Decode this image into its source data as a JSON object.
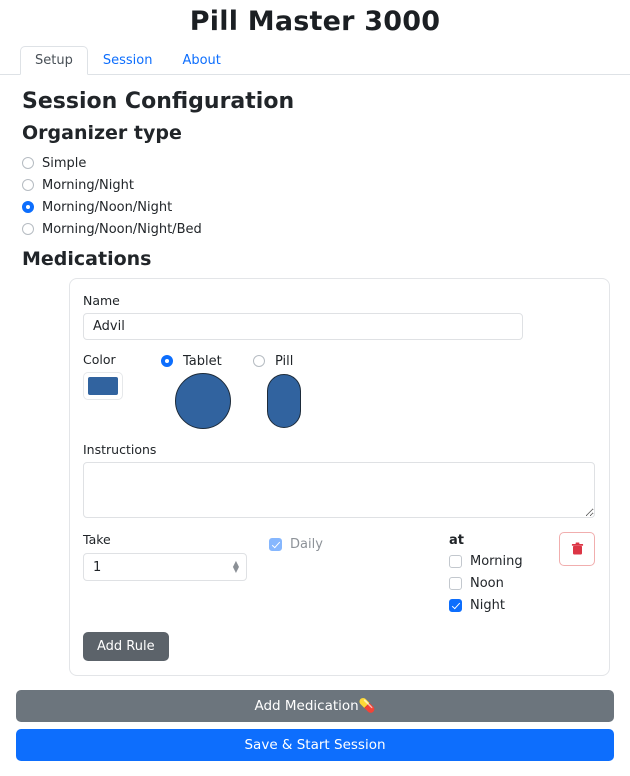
{
  "app": {
    "title": "Pill Master 3000"
  },
  "tabs": [
    {
      "label": "Setup",
      "active": true
    },
    {
      "label": "Session",
      "active": false
    },
    {
      "label": "About",
      "active": false
    }
  ],
  "setup": {
    "section_title": "Session Configuration",
    "organizer": {
      "legend": "Organizer type",
      "options": [
        {
          "label": "Simple",
          "checked": false
        },
        {
          "label": "Morning/Night",
          "checked": false
        },
        {
          "label": "Morning/Noon/Night",
          "checked": true
        },
        {
          "label": "Morning/Noon/Night/Bed",
          "checked": false
        }
      ]
    },
    "medications_title": "Medications",
    "medication": {
      "name_label": "Name",
      "name_value": "Advil",
      "name_placeholder": "",
      "color_label": "Color",
      "color_value": "#31639f",
      "shapes": [
        {
          "label": "Tablet",
          "checked": true
        },
        {
          "label": "Pill",
          "checked": false
        }
      ],
      "instructions_label": "Instructions",
      "instructions_value": "",
      "instructions_placeholder": "",
      "rule": {
        "take_label": "Take",
        "take_value": "1",
        "daily_label": "Daily",
        "daily_checked": true,
        "daily_disabled": true,
        "at_label": "at",
        "times": [
          {
            "label": "Morning",
            "checked": false
          },
          {
            "label": "Noon",
            "checked": false
          },
          {
            "label": "Night",
            "checked": true
          }
        ],
        "delete_icon": "trash-icon"
      },
      "add_rule_label": "Add Rule"
    }
  },
  "actions": {
    "add_medication_label": "Add Medication",
    "add_medication_icon": "pill-emoji",
    "save_label": "Save & Start Session"
  },
  "colors": {
    "accent": "#0d6efd",
    "secondary": "#6c757d",
    "danger": "#dc3545",
    "pill_blue": "#31639f"
  }
}
